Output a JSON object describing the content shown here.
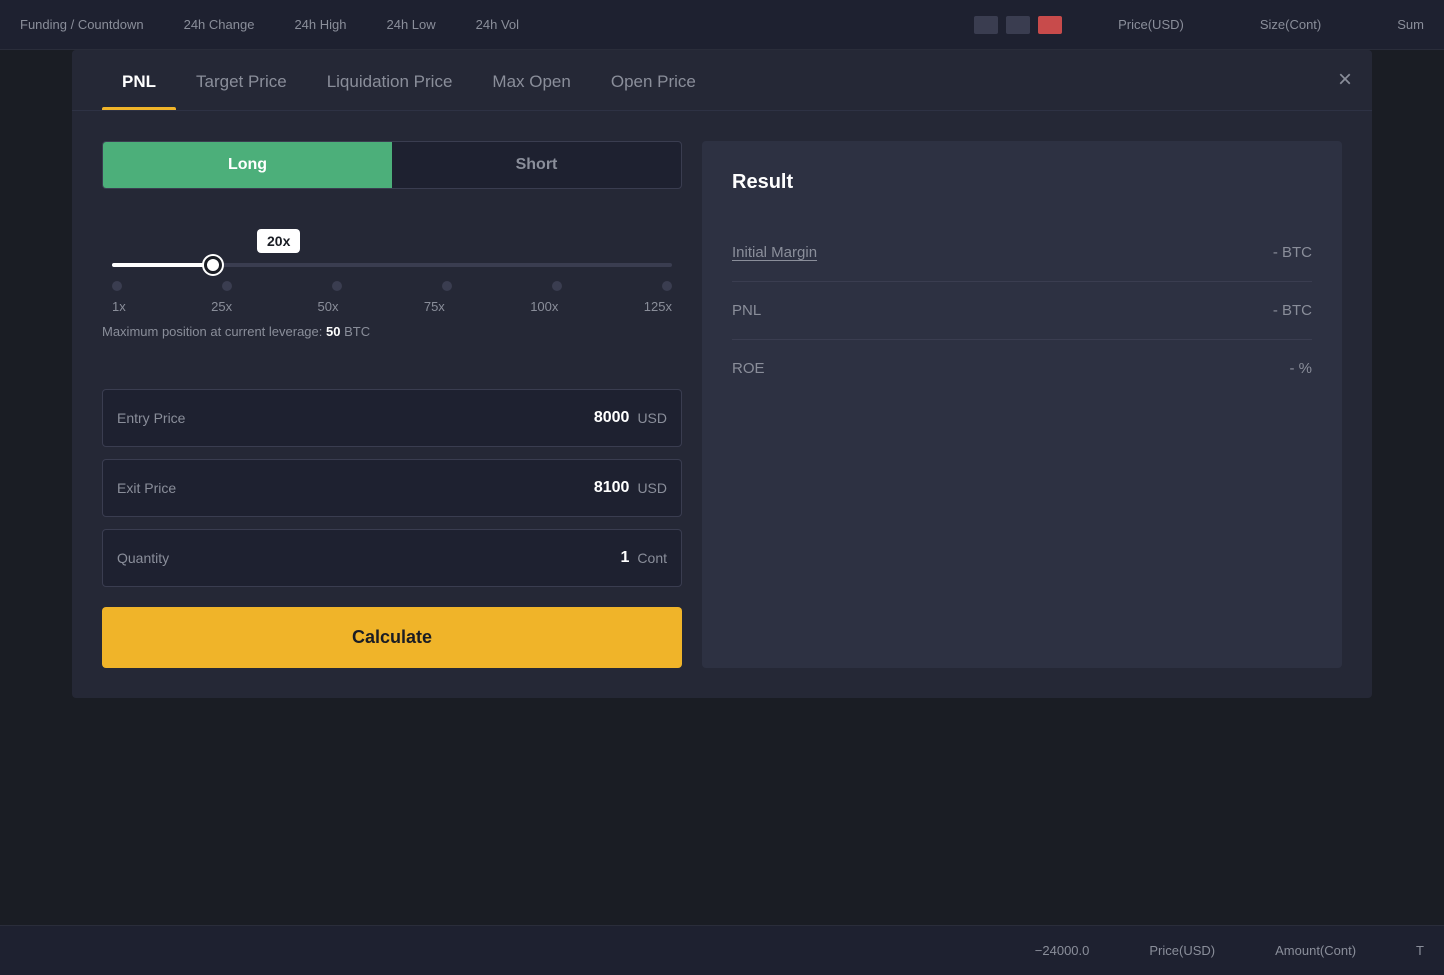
{
  "topBar": {
    "items": [
      "Funding / Countdown",
      "24h Change",
      "24h High",
      "24h Low",
      "24h Vol"
    ],
    "priceLabel": "Price(USD)",
    "sizeLabel": "Size(Cont)",
    "sumLabel": "Sum"
  },
  "bottomBar": {
    "value": "−24000.0",
    "priceLabel": "Price(USD)",
    "amountLabel": "Amount(Cont)",
    "tLabel": "T"
  },
  "modal": {
    "tabs": [
      {
        "id": "pnl",
        "label": "PNL",
        "active": true
      },
      {
        "id": "target-price",
        "label": "Target Price",
        "active": false
      },
      {
        "id": "liquidation-price",
        "label": "Liquidation Price",
        "active": false
      },
      {
        "id": "max-open",
        "label": "Max Open",
        "active": false
      },
      {
        "id": "open-price",
        "label": "Open Price",
        "active": false
      }
    ],
    "closeLabel": "×",
    "toggle": {
      "longLabel": "Long",
      "shortLabel": "Short",
      "activeState": "long"
    },
    "leverage": {
      "current": "20x",
      "marks": [
        "1x",
        "25x",
        "50x",
        "75x",
        "100x",
        "125x"
      ],
      "maxPositionText": "Maximum position at current leverage:",
      "maxPositionValue": "50",
      "maxPositionUnit": "BTC"
    },
    "fields": [
      {
        "label": "Entry Price",
        "value": "8000",
        "unit": "USD"
      },
      {
        "label": "Exit Price",
        "value": "8100",
        "unit": "USD"
      },
      {
        "label": "Quantity",
        "value": "1",
        "unit": "Cont"
      }
    ],
    "calculateLabel": "Calculate",
    "result": {
      "title": "Result",
      "rows": [
        {
          "label": "Initial Margin",
          "underlined": true,
          "value": "- BTC"
        },
        {
          "label": "PNL",
          "underlined": false,
          "value": "- BTC"
        },
        {
          "label": "ROE",
          "underlined": false,
          "value": "- %"
        }
      ]
    }
  }
}
